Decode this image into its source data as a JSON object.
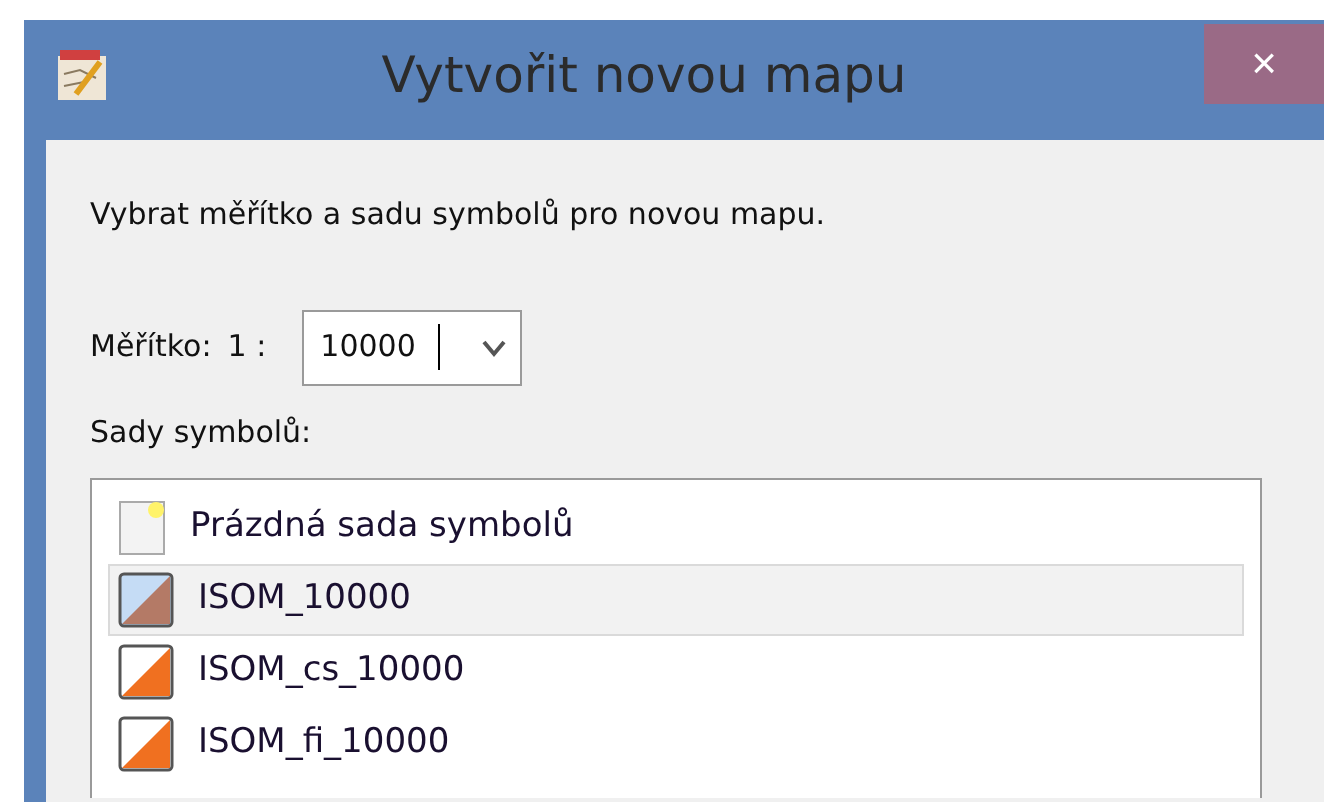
{
  "window": {
    "title": "Vytvořit novou mapu",
    "close": "×"
  },
  "intro": "Vybrat měřítko a sadu symbolů pro novou mapu.",
  "scale": {
    "label": "Měřítko:",
    "prefix": "1 :",
    "value": "10000"
  },
  "symbol_sets": {
    "label": "Sady symbolů:",
    "items": [
      {
        "label": "Prázdná sada symbolů",
        "kind": "blank",
        "selected": false
      },
      {
        "label": "ISOM_10000",
        "kind": "tinted",
        "selected": true
      },
      {
        "label": "ISOM_cs_10000",
        "kind": "plain",
        "selected": false
      },
      {
        "label": "ISOM_fi_10000",
        "kind": "plain",
        "selected": false
      }
    ]
  }
}
